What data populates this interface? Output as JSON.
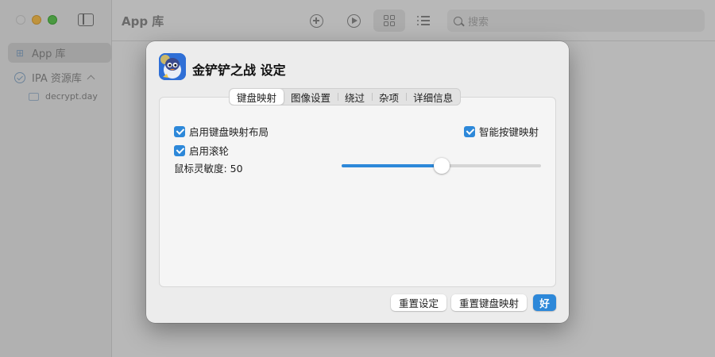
{
  "app": {
    "title": "App 库"
  },
  "toolbar": {
    "search_placeholder": "搜索"
  },
  "sidebar": {
    "items": [
      {
        "label": "App 库",
        "active": true
      },
      {
        "label": "IPA 资源库",
        "expanded": true
      },
      {
        "label": "decrypt.day"
      }
    ]
  },
  "dialog": {
    "title": "金铲铲之战 设定",
    "tabs": [
      {
        "label": "键盘映射",
        "active": true
      },
      {
        "label": "图像设置"
      },
      {
        "label": "绕过"
      },
      {
        "label": "杂项"
      },
      {
        "label": "详细信息"
      }
    ],
    "options": {
      "enable_keymap_layout": {
        "label": "启用键盘映射布局",
        "checked": true
      },
      "enable_scroll": {
        "label": "启用滚轮",
        "checked": true
      },
      "smart_keymap": {
        "label": "智能按键映射",
        "checked": true
      }
    },
    "mouse_sensitivity": {
      "label": "鼠标灵敏度: 50",
      "value": 50,
      "fraction": 0.5
    },
    "buttons": {
      "reset_settings": "重置设定",
      "reset_keymap": "重置键盘映射",
      "ok": "好"
    }
  },
  "colors": {
    "accent": "#2d88d9"
  }
}
